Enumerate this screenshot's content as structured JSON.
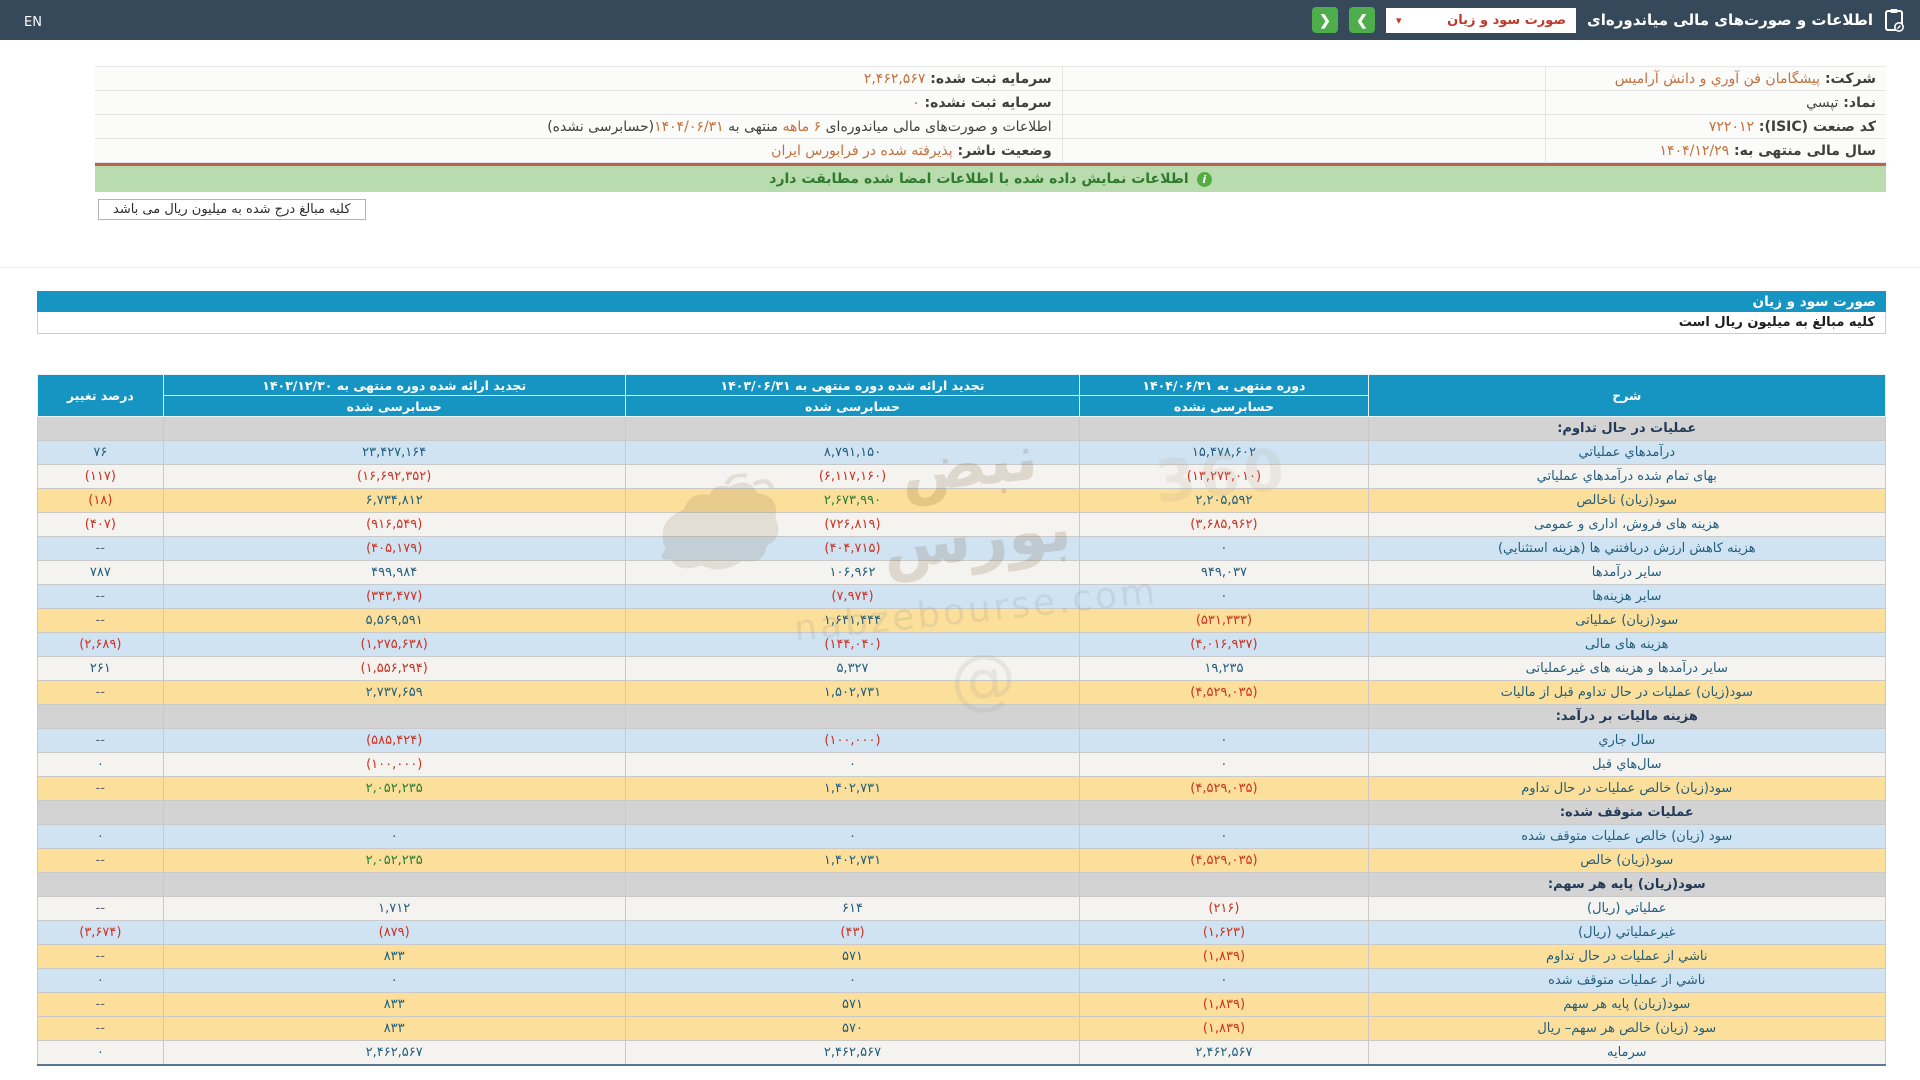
{
  "navbar": {
    "en_label": "EN",
    "title": "اطلاعات و صورت‌های مالی میاندوره‌ای",
    "dropdown_value": "صورت سود و زیان",
    "dropdown_caret": "▾",
    "next_icon": "❯",
    "prev_icon": "❮"
  },
  "info": {
    "rows": [
      {
        "right": [
          {
            "t": "شرکت: ",
            "c": "lbl"
          },
          {
            "t": "پیشگامان فن آوري و دانش آرامیس",
            "c": "org"
          }
        ],
        "left": [
          {
            "t": "سرمایه ثبت شده: ",
            "c": "lbl"
          },
          {
            "t": "۲,۴۶۲,۵۶۷",
            "c": "org"
          }
        ]
      },
      {
        "right": [
          {
            "t": "نماد: ",
            "c": "lbl"
          },
          {
            "t": "تپسي",
            "c": "val"
          }
        ],
        "left": [
          {
            "t": "سرمایه ثبت نشده: ",
            "c": "lbl"
          },
          {
            "t": "۰",
            "c": "org"
          }
        ]
      },
      {
        "right": [
          {
            "t": "کد صنعت (ISIC): ",
            "c": "lbl"
          },
          {
            "t": "۷۲۲۰۱۲",
            "c": "org"
          }
        ],
        "left": [
          {
            "t": "اطلاعات و صورت‌های مالی میاندوره‌ای ",
            "c": "plain"
          },
          {
            "t": "۶ ماهه",
            "c": "org"
          },
          {
            "t": " منتهی به ",
            "c": "plain"
          },
          {
            "t": "۱۴۰۴/۰۶/۳۱",
            "c": "org"
          },
          {
            "t": "(حسابرسی نشده)",
            "c": "plain"
          }
        ]
      },
      {
        "right": [
          {
            "t": "سال مالی منتهی به: ",
            "c": "lbl"
          },
          {
            "t": "۱۴۰۴/۱۲/۲۹",
            "c": "org"
          }
        ],
        "left": [
          {
            "t": "وضعیت ناشر: ",
            "c": "lbl"
          },
          {
            "t": "پذیرفته شده در فرابورس ایران",
            "c": "org"
          }
        ]
      }
    ]
  },
  "notice": {
    "text": "اطلاعات نمایش داده شده با اطلاعات امضا شده مطابقت دارد",
    "icon": "i"
  },
  "unit_box": "کلیه مبالغ درج شده به میلیون ریال می باشد",
  "statement": {
    "title": "صورت سود و زیان",
    "unit_note": "کلیه مبالغ به میلیون ریال است"
  },
  "table": {
    "columns": [
      {
        "key": "desc",
        "title": "شرح",
        "sub": null
      },
      {
        "key": "v1",
        "title": "دوره منتهی به ۱۴۰۴/۰۶/۳۱",
        "sub": "حسابرسی نشده"
      },
      {
        "key": "v2",
        "title": "تجدید ارائه شده دوره منتهی به ۱۴۰۳/۰۶/۳۱",
        "sub": "حسابرسی شده"
      },
      {
        "key": "v3",
        "title": "تجدید ارائه شده دوره منتهی به ۱۴۰۳/۱۲/۳۰",
        "sub": "حسابرسی شده"
      },
      {
        "key": "chg",
        "title": "درصد تغییر",
        "sub": null
      }
    ],
    "rows": [
      {
        "t": "section",
        "desc": "عملیات در حال تداوم:"
      },
      {
        "t": "row",
        "bg": "blue",
        "desc": "درآمدهاي عملياتي",
        "v1": "۱۵,۴۷۸,۶۰۲",
        "v2": "۸,۷۹۱,۱۵۰",
        "v3": "۲۳,۴۲۷,۱۶۴",
        "chg": "۷۶"
      },
      {
        "t": "row",
        "bg": "white",
        "desc": "بهای تمام شده درآمدهاي عملياتي",
        "v1": "(۱۳,۲۷۳,۰۱۰)",
        "v2": "(۶,۱۱۷,۱۶۰)",
        "v3": "(۱۶,۶۹۲,۳۵۲)",
        "chg": "(۱۱۷)"
      },
      {
        "t": "row",
        "bg": "yellow",
        "desc": "سود(زیان) ناخالص",
        "v1": "۲,۲۰۵,۵۹۲",
        "v2": "۲,۶۷۳,۹۹۰",
        "v3": "۶,۷۳۴,۸۱۲",
        "chg": "(۱۸)",
        "green": [
          "v2"
        ]
      },
      {
        "t": "row",
        "bg": "white",
        "desc": "هزینه های فروش، اداری و عمومی",
        "v1": "(۳,۶۸۵,۹۶۲)",
        "v2": "(۷۲۶,۸۱۹)",
        "v3": "(۹۱۶,۵۴۹)",
        "chg": "(۴۰۷)"
      },
      {
        "t": "row",
        "bg": "blue",
        "desc": "هزینه کاهش ارزش دریافتني ها (هزینه استثنایي)",
        "v1": "۰",
        "v2": "(۴۰۴,۷۱۵)",
        "v3": "(۴۰۵,۱۷۹)",
        "chg": "--"
      },
      {
        "t": "row",
        "bg": "white",
        "desc": "سایر درآمدها",
        "v1": "۹۴۹,۰۳۷",
        "v2": "۱۰۶,۹۶۲",
        "v3": "۴۹۹,۹۸۴",
        "chg": "۷۸۷"
      },
      {
        "t": "row",
        "bg": "blue",
        "desc": "سایر هزینه‌ها",
        "v1": "۰",
        "v2": "(۷,۹۷۴)",
        "v3": "(۳۴۳,۴۷۷)",
        "chg": "--"
      },
      {
        "t": "row",
        "bg": "yellow",
        "desc": "سود(زیان) عملیاتی",
        "v1": "(۵۳۱,۳۳۳)",
        "v2": "۱,۶۴۱,۴۴۴",
        "v3": "۵,۵۶۹,۵۹۱",
        "chg": "--"
      },
      {
        "t": "row",
        "bg": "blue",
        "desc": "هزینه های مالی",
        "v1": "(۴,۰۱۶,۹۳۷)",
        "v2": "(۱۴۴,۰۴۰)",
        "v3": "(۱,۲۷۵,۶۳۸)",
        "chg": "(۲,۶۸۹)"
      },
      {
        "t": "row",
        "bg": "white",
        "desc": "سایر درآمدها و هزینه های غیرعملیاتی",
        "v1": "۱۹,۲۳۵",
        "v2": "۵,۳۲۷",
        "v3": "(۱,۵۵۶,۲۹۴)",
        "chg": "۲۶۱"
      },
      {
        "t": "row",
        "bg": "yellow",
        "desc": "سود(زیان) عملیات در حال تداوم قبل از مالیات",
        "v1": "(۴,۵۲۹,۰۳۵)",
        "v2": "۱,۵۰۲,۷۳۱",
        "v3": "۲,۷۳۷,۶۵۹",
        "chg": "--"
      },
      {
        "t": "section",
        "desc": "هزینه مالیات بر درآمد:"
      },
      {
        "t": "row",
        "bg": "blue",
        "desc": "سال جاري",
        "v1": "۰",
        "v2": "(۱۰۰,۰۰۰)",
        "v3": "(۵۸۵,۴۲۴)",
        "chg": "--"
      },
      {
        "t": "row",
        "bg": "white",
        "desc": "سال‌هاي قبل",
        "v1": "۰",
        "v2": "۰",
        "v3": "(۱۰۰,۰۰۰)",
        "chg": "۰"
      },
      {
        "t": "row",
        "bg": "yellow",
        "desc": "سود(زیان) خالص عملیات در حال تداوم",
        "v1": "(۴,۵۲۹,۰۳۵)",
        "v2": "۱,۴۰۲,۷۳۱",
        "v3": "۲,۰۵۲,۲۳۵",
        "chg": "--",
        "green": [
          "v3"
        ]
      },
      {
        "t": "section",
        "desc": "عملیات متوقف شده:"
      },
      {
        "t": "row",
        "bg": "blue",
        "desc": "سود (زیان) خالص عملیات متوقف شده",
        "v1": "۰",
        "v2": "۰",
        "v3": "۰",
        "chg": "۰"
      },
      {
        "t": "row",
        "bg": "yellow",
        "desc": "سود(زیان) خالص",
        "v1": "(۴,۵۲۹,۰۳۵)",
        "v2": "۱,۴۰۲,۷۳۱",
        "v3": "۲,۰۵۲,۲۳۵",
        "chg": "--",
        "green": [
          "v3"
        ]
      },
      {
        "t": "section",
        "desc": "سود(زیان) پایه هر سهم:"
      },
      {
        "t": "row",
        "bg": "white",
        "desc": "عملیاتي (ریال)",
        "v1": "(۲۱۶)",
        "v2": "۶۱۴",
        "v3": "۱,۷۱۲",
        "chg": "--"
      },
      {
        "t": "row",
        "bg": "blue",
        "desc": "غیرعملیاتي (ریال)",
        "v1": "(۱,۶۲۳)",
        "v2": "(۴۳)",
        "v3": "(۸۷۹)",
        "chg": "(۳,۶۷۴)"
      },
      {
        "t": "row",
        "bg": "yellow",
        "desc": "ناشي از عملیات در حال تداوم",
        "v1": "(۱,۸۳۹)",
        "v2": "۵۷۱",
        "v3": "۸۳۳",
        "chg": "--"
      },
      {
        "t": "row",
        "bg": "blue",
        "desc": "ناشي از عملیات متوقف شده",
        "v1": "۰",
        "v2": "۰",
        "v3": "۰",
        "chg": "۰"
      },
      {
        "t": "row",
        "bg": "yellow",
        "desc": "سود(زیان) پایه هر سهم",
        "v1": "(۱,۸۳۹)",
        "v2": "۵۷۱",
        "v3": "۸۳۳",
        "chg": "--"
      },
      {
        "t": "row",
        "bg": "yellow",
        "desc": "سود (زیان) خالص هر سهم– ریال",
        "v1": "(۱,۸۳۹)",
        "v2": "۵۷۰",
        "v3": "۸۳۳",
        "chg": "--"
      },
      {
        "t": "row",
        "bg": "white",
        "desc": "سرمایه",
        "v1": "۲,۴۶۲,۵۶۷",
        "v2": "۲,۴۶۲,۵۶۷",
        "v3": "۲,۴۶۲,۵۶۷",
        "chg": "۰"
      }
    ]
  },
  "watermark": {
    "fa": "نبض بورس",
    "num": "360",
    "en": "nabzebourse.com",
    "at": "@"
  },
  "colors": {
    "accent": "#1795c2",
    "navbar": "#36495a",
    "btn_green": "#4fae4c",
    "dd_red": "#c0392b",
    "row_blue": "#cfe3f3",
    "row_white": "#f4f3f0",
    "row_yellow": "#fbdf9a",
    "row_section": "#d3d3d3",
    "pos": "#235e7d",
    "neg": "#cc3322",
    "grn": "#2e7d32",
    "orange": "#c2703d",
    "notice_bg": "#b9dcae",
    "notice_text": "#2f7a2f",
    "red_line": "#c0604f"
  }
}
